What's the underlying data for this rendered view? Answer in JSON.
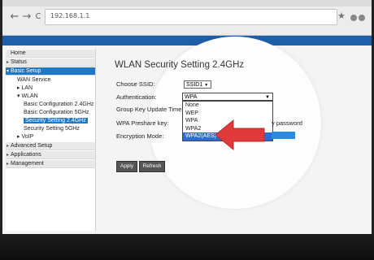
{
  "browser": {
    "url": "192.168.1.1",
    "back": "←",
    "forward": "→",
    "reload": "C",
    "star": "★"
  },
  "sidebar": {
    "items": [
      {
        "label": "Home"
      },
      {
        "label": "Status"
      },
      {
        "label": "Basic Setup"
      },
      {
        "label": "WAN Service"
      },
      {
        "label": "LAN"
      },
      {
        "label": "WLAN"
      },
      {
        "label": "Basic Configuration 2.4GHz"
      },
      {
        "label": "Basic Configuration 5GHz"
      },
      {
        "label": "Security Setting 2.4GHz"
      },
      {
        "label": "Security Setting 5GHz"
      },
      {
        "label": "VoIP"
      },
      {
        "label": "Advanced Setup"
      },
      {
        "label": "Applications"
      },
      {
        "label": "Management"
      }
    ]
  },
  "main": {
    "title": "WLAN Security Setting 2.4GHz",
    "choose_ssid_label": "Choose SSID:",
    "ssid_value": "SSID1",
    "authentication_label": "Authentication:",
    "authentication_value": "WPA",
    "group_key_label": "Group Key Update Timer:",
    "preshare_label": "WPA Preshare key:",
    "encryption_label": "Encryption Mode:",
    "show_password_fragment": "y password",
    "auth_options": [
      "None",
      "WEP",
      "WPA",
      "WPA2",
      "WPA2(AES)"
    ],
    "apply_label": "Apply",
    "refresh_label": "Refresh"
  },
  "colors": {
    "accent": "#1e78c8",
    "selected_option": "#2b6fd6",
    "arrow": "#e03a3a"
  },
  "icons": [
    "back-icon",
    "forward-icon",
    "reload-icon",
    "star-icon",
    "caret-icon",
    "red-arrow-icon"
  ]
}
